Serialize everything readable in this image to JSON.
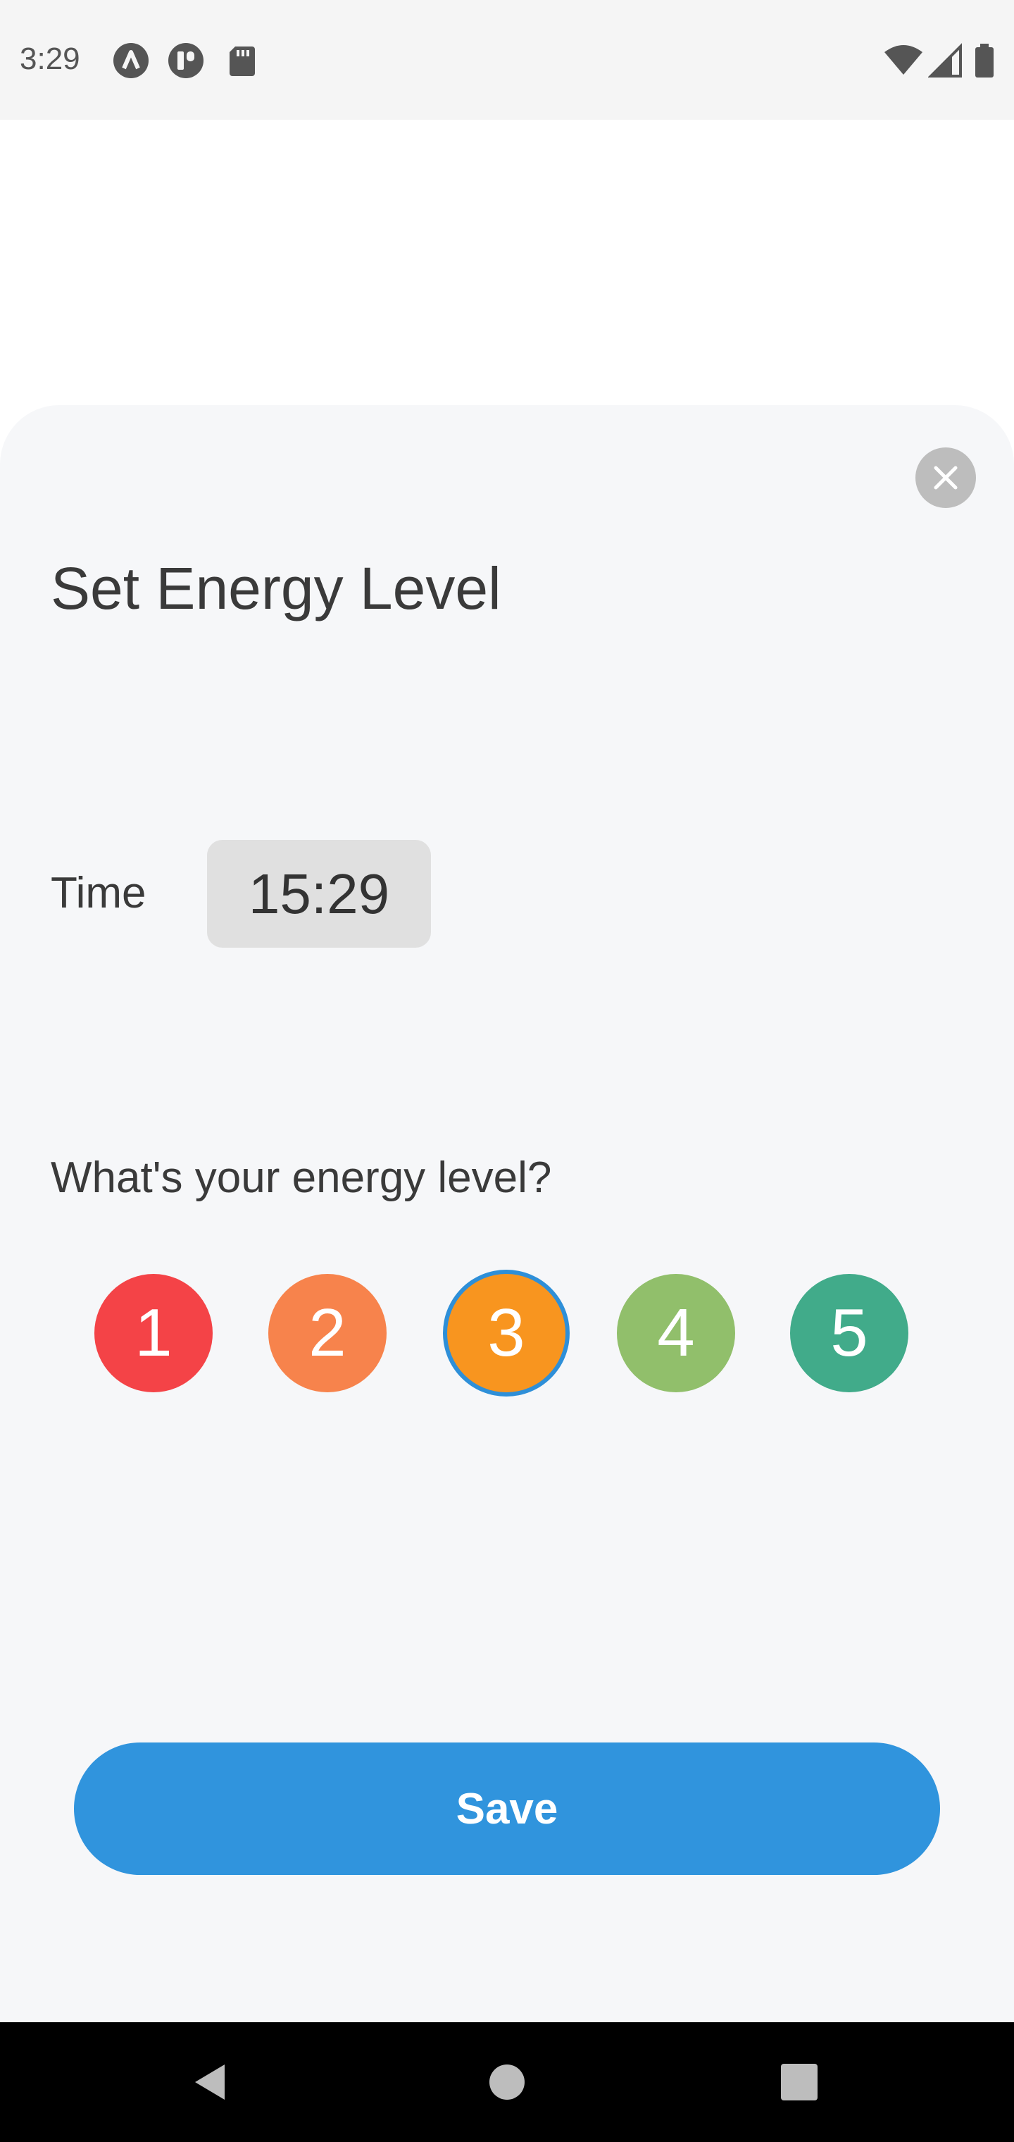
{
  "status_bar": {
    "time": "3:29",
    "left_icons": [
      "a-circle-icon",
      "pause-circle-icon",
      "sd-card-icon"
    ],
    "right_icons": [
      "wifi-icon",
      "cellular-signal-icon",
      "battery-icon"
    ]
  },
  "sheet": {
    "title": "Set Energy Level",
    "close_icon": "close-icon",
    "time_label": "Time",
    "time_value": "15:29",
    "question": "What's your energy level?",
    "levels": [
      {
        "label": "1",
        "color": "#f44347"
      },
      {
        "label": "2",
        "color": "#f7834c"
      },
      {
        "label": "3",
        "color": "#f8951f"
      },
      {
        "label": "4",
        "color": "#91bf6b"
      },
      {
        "label": "5",
        "color": "#41ab8a"
      }
    ],
    "selected_level": "3",
    "selection_ring_color": "#2e8fd8",
    "save_label": "Save",
    "save_color": "#3094dd"
  },
  "nav_bar": {
    "icons": [
      "back-icon",
      "home-icon",
      "recents-icon"
    ]
  }
}
